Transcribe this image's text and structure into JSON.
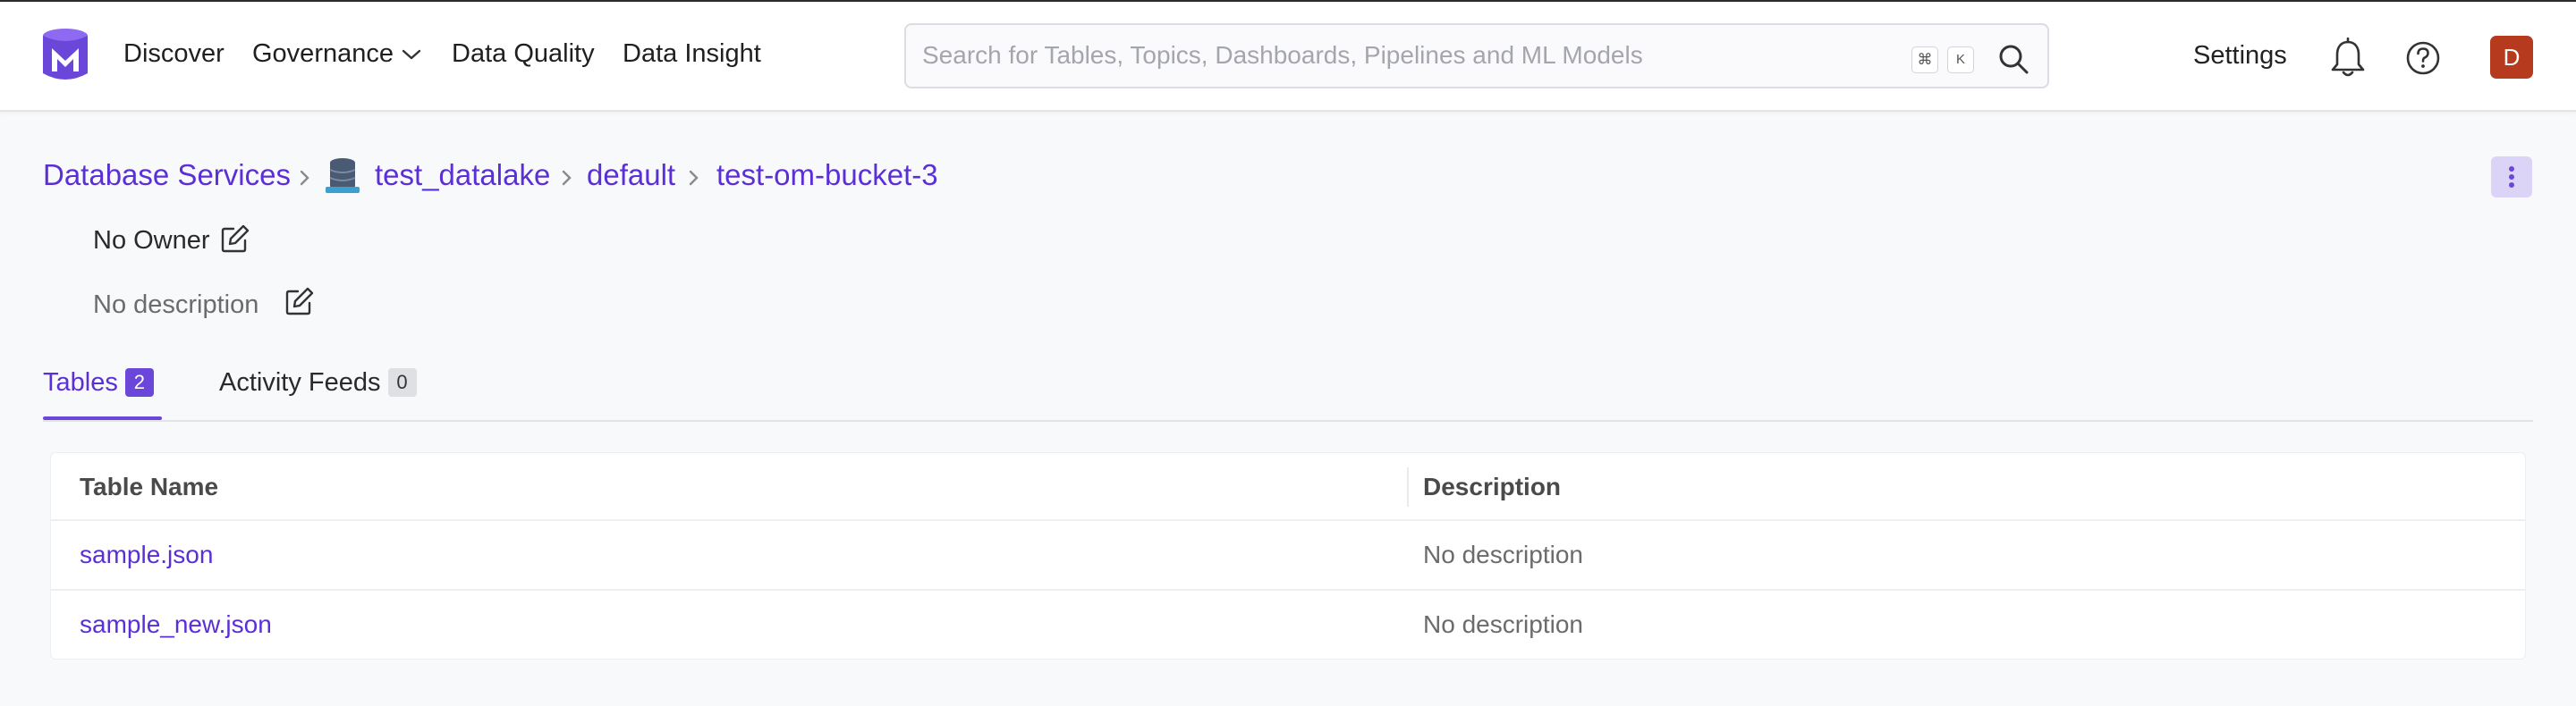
{
  "navbar": {
    "links": [
      "Discover",
      "Governance",
      "Data Quality",
      "Data Insight"
    ],
    "search_placeholder": "Search for Tables, Topics, Dashboards, Pipelines and ML Models",
    "shortcut_keys": [
      "⌘",
      "K"
    ],
    "settings_label": "Settings",
    "avatar_initial": "D",
    "avatar_color": "#b53a1e"
  },
  "breadcrumb": {
    "items": [
      "Database Services",
      "test_datalake",
      "default",
      "test-om-bucket-3"
    ]
  },
  "entity": {
    "owner_label": "No Owner",
    "description": "No description"
  },
  "tabs": [
    {
      "label": "Tables",
      "count": "2",
      "active": true
    },
    {
      "label": "Activity Feeds",
      "count": "0",
      "active": false
    }
  ],
  "table": {
    "columns": [
      "Table Name",
      "Description"
    ],
    "rows": [
      {
        "name": "sample.json",
        "description": "No description"
      },
      {
        "name": "sample_new.json",
        "description": "No description"
      }
    ]
  },
  "colors": {
    "accent": "#5b2fd6",
    "accent_bg": "#6a47d9"
  }
}
